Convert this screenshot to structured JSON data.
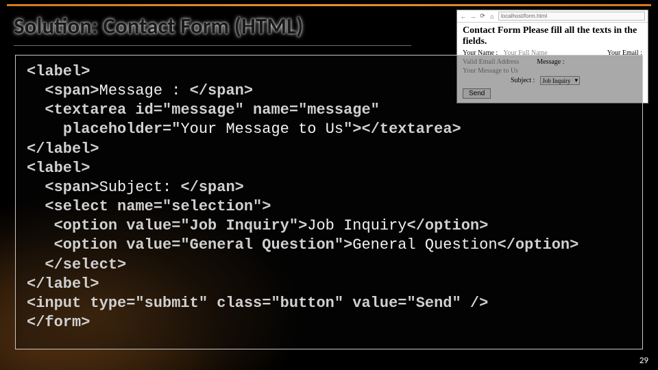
{
  "slide": {
    "title": "Solution: Contact Form (HTML)",
    "number": "29"
  },
  "preview": {
    "heading": "Contact Form Please fill all the texts in the fields.",
    "addr_placeholder": "localhost/form.html",
    "name_label": "Your Name :",
    "name_value": "Your Full Name",
    "email_label": "Your Email :",
    "email_value": "Valid Email Address",
    "msg_label": "Message :",
    "msg_value": "Your Message to Us",
    "subject_label": "Subject :",
    "subject_value": "Job Inquiry",
    "send": "Send"
  },
  "code": {
    "l1_open": "<label>",
    "l2_a": "<span>",
    "l2_b": "Message : ",
    "l2_c": "</span>",
    "l3": "<textarea id=\"message\" name=\"message\"",
    "l4_a": "placeholder=\"",
    "l4_b": "Your Message to Us",
    "l4_c": "\"></textarea>",
    "l5": "</label>",
    "l6": "<label>",
    "l7_a": "<span>",
    "l7_b": "Subject: ",
    "l7_c": "</span>",
    "l8": "<select name=\"selection\">",
    "l9_a": "<option value=\"Job Inquiry\">",
    "l9_b": "Job Inquiry",
    "l9_c": "</option>",
    "l10_a": "<option value=\"General Question\">",
    "l10_b": "General Question",
    "l10_c": "</option>",
    "l11": "</select>",
    "l12": "</label>",
    "l13": "<input type=\"submit\" class=\"button\" value=\"Send\" />",
    "l14": "</form>"
  }
}
